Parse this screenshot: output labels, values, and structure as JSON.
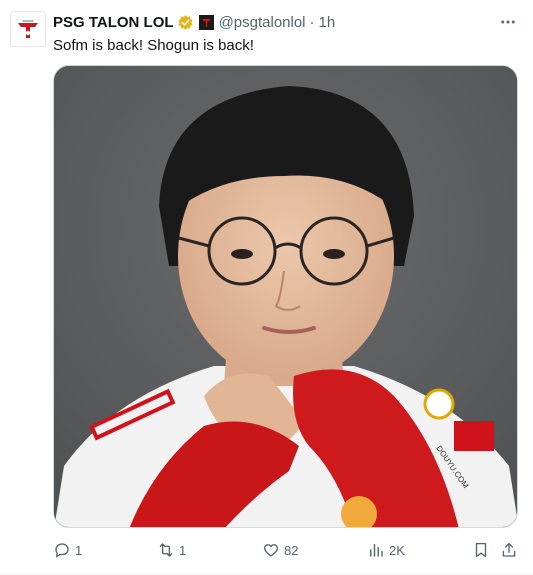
{
  "tweet": {
    "account_name": "PSG TALON LOL",
    "handle": "@psgtalonlol",
    "separator": "·",
    "time": "1h",
    "text": "Sofm is back! Shogun is back!",
    "avatar_icon": "psg-talon-logo-icon",
    "verified_icon": "gold-checkmark-icon",
    "affiliate_icon": "affiliate-badge-icon",
    "more_icon": "more-icon"
  },
  "media": {
    "photo_brand_text": "DOUYU.COM"
  },
  "actions": {
    "replies": "1",
    "retweets": "1",
    "likes": "82",
    "views": "2K",
    "reply_icon": "reply-icon",
    "retweet_icon": "retweet-icon",
    "like_icon": "heart-icon",
    "views_icon": "views-icon",
    "bookmark_icon": "bookmark-icon",
    "share_icon": "share-icon"
  },
  "colors": {
    "text_primary": "#0f1419",
    "text_secondary": "#536471",
    "verified_gold": "#e2b719",
    "brand_red": "#d0121b",
    "photo_background": "#5a5b5d"
  }
}
